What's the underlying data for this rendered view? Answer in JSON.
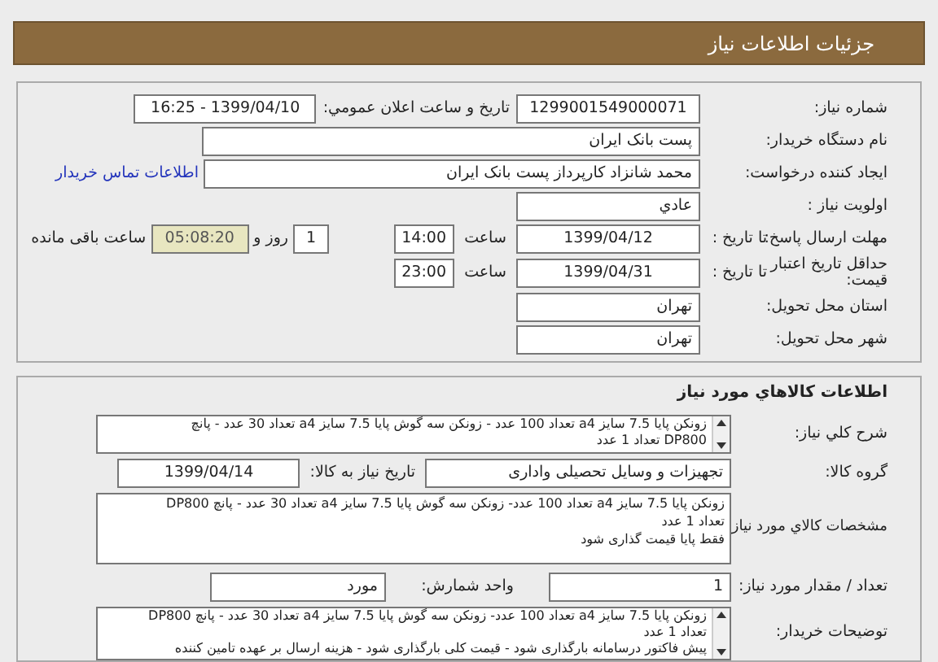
{
  "header": {
    "title": "جزئیات اطلاعات نیاز"
  },
  "details": {
    "need_number": {
      "label": "شماره نیاز:",
      "value": "1299001549000071"
    },
    "announce": {
      "label": "تاريخ و ساعت اعلان عمومي:",
      "value": "1399/04/10 - 16:25"
    },
    "buyer": {
      "label": "نام دستگاه خریدار:",
      "value": "پست بانک ایران"
    },
    "creator": {
      "label": "ایجاد کننده درخواست:",
      "value": "محمد شانزاد کارپرداز پست بانک ایران",
      "link": "اطلاعات تماس خریدار"
    },
    "priority": {
      "label": "اولویت نیاز :",
      "value": "عادي"
    },
    "deadline": {
      "label": "مهلت ارسال پاسخ:",
      "to_date_label": "تا تاریخ :",
      "date": "1399/04/12",
      "time_label": "ساعت",
      "time": "14:00",
      "days": "1",
      "days_label": "روز و",
      "remaining": "05:08:20",
      "remaining_label": "ساعت باقی مانده"
    },
    "validity": {
      "label": "حداقل تاریخ اعتبار قیمت:",
      "to_date_label": "تا تاریخ :",
      "date": "1399/04/31",
      "time_label": "ساعت",
      "time": "23:00"
    },
    "province": {
      "label": "استان محل تحویل:",
      "value": "تهران"
    },
    "city": {
      "label": "شهر محل تحویل:",
      "value": "تهران"
    }
  },
  "goods": {
    "title": "اطلاعات کالاهاي مورد نياز",
    "summary": {
      "label": "شرح کلي نياز:",
      "lines": [
        "زونکن پایا 7.5 سایز a4 تعداد 100 عدد - زونکن سه گوش پایا 7.5 سایز a4 تعداد 30 عدد - پانچ",
        "DP800  تعداد 1 عدد"
      ]
    },
    "group": {
      "label": "گروه کالا:",
      "value": "تجهیزات و وسایل تحصیلی واداری",
      "date_label": "تاریخ نیاز به کالا:",
      "date": "1399/04/14"
    },
    "specs": {
      "label": "مشخصات کالاي مورد نياز:",
      "lines": [
        "زونکن پایا 7.5 سایز a4 تعداد 100 عدد-  زونکن سه گوش پایا 7.5 سایز a4 تعداد 30 عدد - پانچ DP800",
        "تعداد 1 عدد",
        "فقط پایا قیمت گذاری شود"
      ]
    },
    "quantity": {
      "label": "تعداد / مقدار مورد نیاز:",
      "value": "1",
      "unit_label": "واحد شمارش:",
      "unit": "مورد"
    },
    "notes": {
      "label": "توضیحات خریدار:",
      "lines": [
        "زونکن پایا 7.5 سایز a4 تعداد 100 عدد-  زونکن سه گوش پایا 7.5 سایز a4 تعداد 30 عدد - پانچ DP800",
        "تعداد 1 عدد",
        "پیش فاکتور درسامانه بارگذاری شود - قیمت کلی بارگذاری شود - هزینه ارسال بر عهده تامین کننده"
      ]
    }
  }
}
